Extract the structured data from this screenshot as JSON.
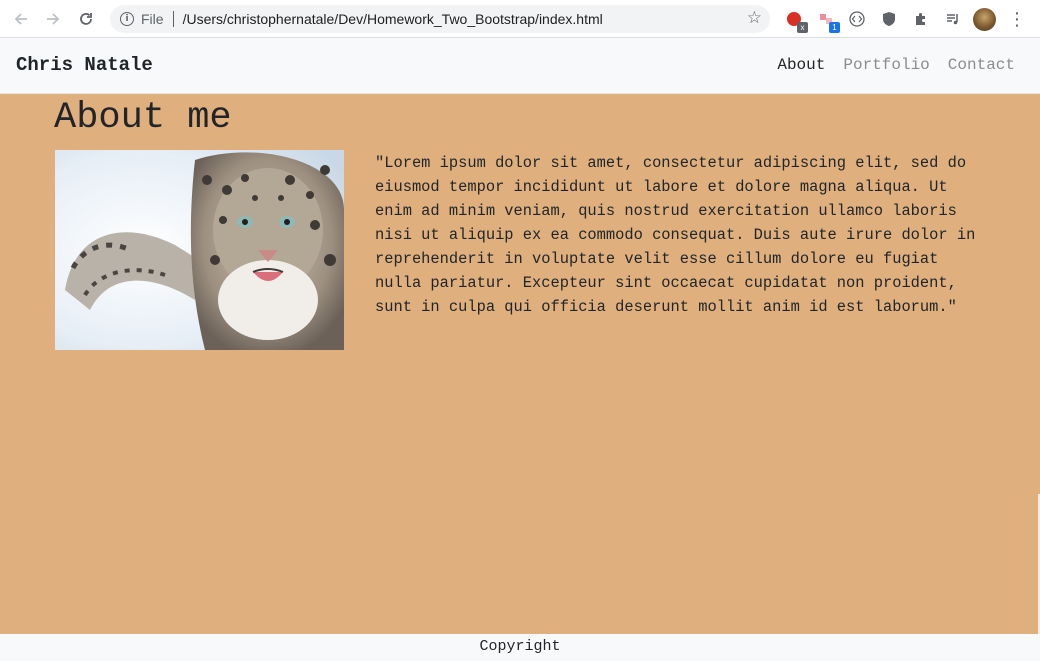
{
  "browser": {
    "scheme_label": "File",
    "url": "/Users/christophernatale/Dev/Homework_Two_Bootstrap/index.html",
    "extensions": [
      {
        "name": "extension-red-icon",
        "badge": "x"
      },
      {
        "name": "extension-puzzle-badge-icon",
        "badge": "1"
      },
      {
        "name": "extension-code-icon",
        "badge": ""
      },
      {
        "name": "extension-shield-icon",
        "badge": ""
      },
      {
        "name": "extensions-icon",
        "badge": ""
      },
      {
        "name": "media-control-icon",
        "badge": ""
      }
    ]
  },
  "navbar": {
    "brand": "Chris Natale",
    "links": [
      {
        "label": "About",
        "active": true
      },
      {
        "label": "Portfolio",
        "active": false
      },
      {
        "label": "Contact",
        "active": false
      }
    ]
  },
  "main": {
    "title": "About me",
    "image": {
      "subject": "snow leopard photo"
    },
    "bio": "\"Lorem ipsum dolor sit amet, consectetur adipiscing elit, sed do eiusmod tempor incididunt ut labore et dolore magna aliqua. Ut enim ad minim veniam, quis nostrud exercitation ullamco laboris nisi ut aliquip ex ea commodo consequat. Duis aute irure dolor in reprehenderit in voluptate velit esse cillum dolore eu fugiat nulla pariatur. Excepteur sint occaecat cupidatat non proident, sunt in culpa qui officia deserunt mollit anim id est laborum.\""
  },
  "footer": {
    "copyright": "Copyright"
  },
  "colors": {
    "background": "#dfb07d",
    "navbar": "#f8f9fa",
    "text": "#212529",
    "muted_link": "#8c8c8c"
  }
}
